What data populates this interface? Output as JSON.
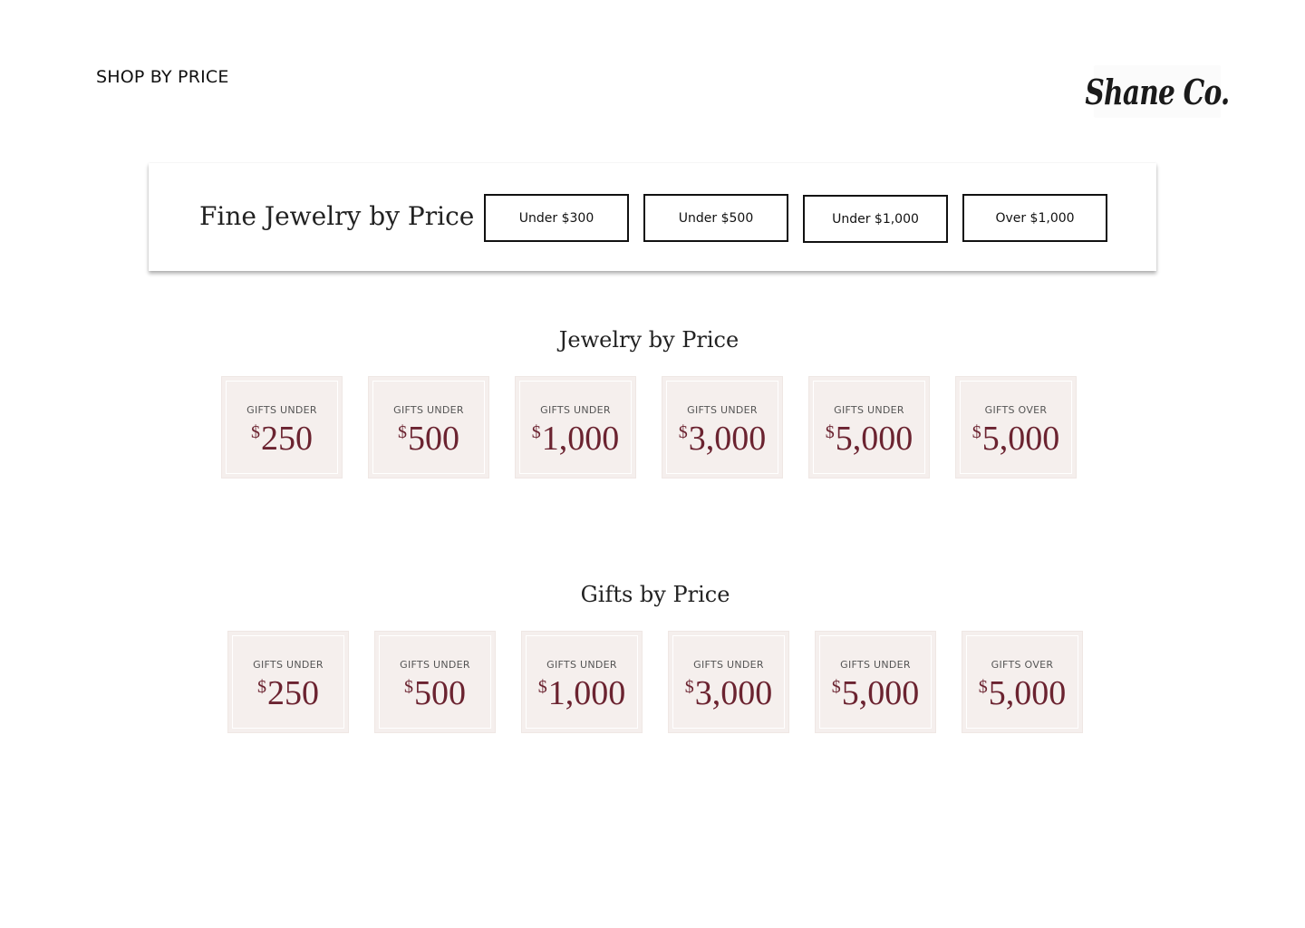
{
  "header": {
    "title": "SHOP BY PRICE"
  },
  "logo": {
    "text": "Shane Co.",
    "registered": "®"
  },
  "fine_jewelry": {
    "title": "Fine Jewelry by Price",
    "buttons": [
      {
        "label": "Under $300"
      },
      {
        "label": "Under $500"
      },
      {
        "label": "Under $1,000"
      },
      {
        "label": "Over $1,000"
      }
    ]
  },
  "jewelry_section": {
    "title": "Jewelry by Price",
    "tiles": [
      {
        "label": "GIFTS UNDER",
        "currency": "$",
        "amount": "250"
      },
      {
        "label": "GIFTS UNDER",
        "currency": "$",
        "amount": "500"
      },
      {
        "label": "GIFTS UNDER",
        "currency": "$",
        "amount": "1,000"
      },
      {
        "label": "GIFTS UNDER",
        "currency": "$",
        "amount": "3,000"
      },
      {
        "label": "GIFTS UNDER",
        "currency": "$",
        "amount": "5,000"
      },
      {
        "label": "GIFTS OVER",
        "currency": "$",
        "amount": "5,000"
      }
    ]
  },
  "gifts_section": {
    "title": "Gifts by Price",
    "tiles": [
      {
        "label": "GIFTS UNDER",
        "currency": "$",
        "amount": "250"
      },
      {
        "label": "GIFTS UNDER",
        "currency": "$",
        "amount": "500"
      },
      {
        "label": "GIFTS UNDER",
        "currency": "$",
        "amount": "1,000"
      },
      {
        "label": "GIFTS UNDER",
        "currency": "$",
        "amount": "3,000"
      },
      {
        "label": "GIFTS UNDER",
        "currency": "$",
        "amount": "5,000"
      },
      {
        "label": "GIFTS OVER",
        "currency": "$",
        "amount": "5,000"
      }
    ]
  },
  "colors": {
    "tile_background": "#f5efed",
    "amount_text": "#6b2330",
    "button_border": "#111111"
  }
}
